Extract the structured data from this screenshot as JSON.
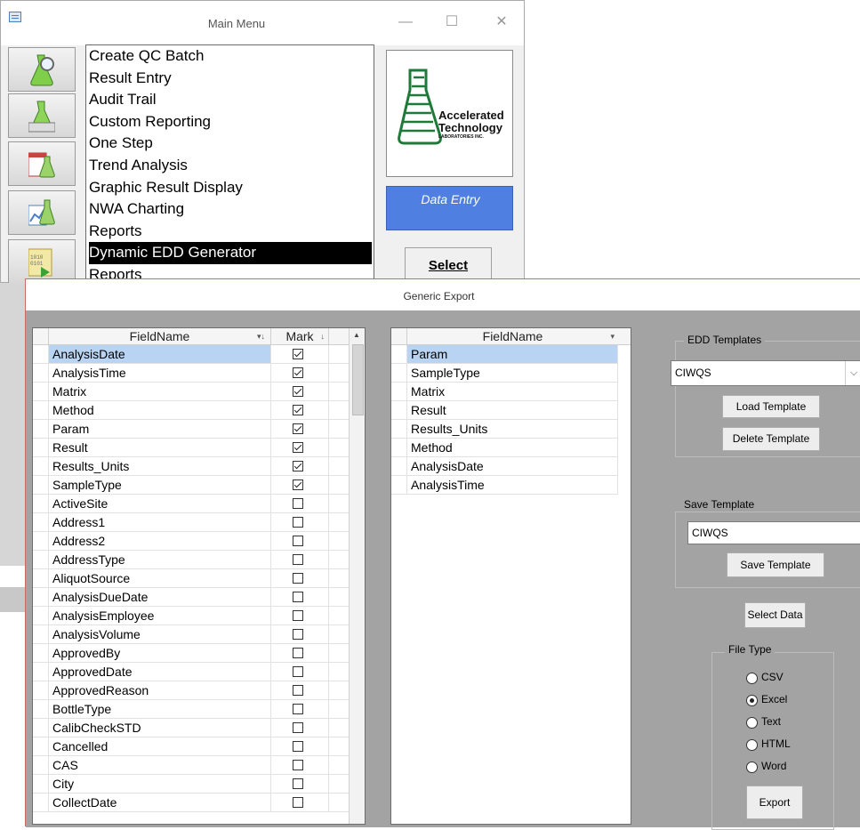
{
  "main_menu": {
    "title": "Main Menu",
    "items": [
      "Create QC Batch",
      "Result Entry",
      "Audit Trail",
      "Custom Reporting",
      "One Step",
      "Trend Analysis",
      "Graphic Result Display",
      "NWA Charting",
      "Reports",
      "Dynamic EDD Generator",
      "Reports"
    ],
    "selected_index": 9,
    "logo": {
      "line1": "Accelerated",
      "line2": "Technology",
      "line3": "LABORATORIES INC."
    },
    "data_entry_label": "Data Entry",
    "select_label": "Select",
    "colors": {
      "data_entry_bg": "#4f7fe0"
    }
  },
  "generic_export": {
    "title": "Generic Export",
    "left_grid": {
      "headers": {
        "field": "FieldName",
        "mark": "Mark"
      },
      "rows": [
        {
          "name": "AnalysisDate",
          "mark": true
        },
        {
          "name": "AnalysisTime",
          "mark": true
        },
        {
          "name": "Matrix",
          "mark": true
        },
        {
          "name": "Method",
          "mark": true
        },
        {
          "name": "Param",
          "mark": true
        },
        {
          "name": "Result",
          "mark": true
        },
        {
          "name": "Results_Units",
          "mark": true
        },
        {
          "name": "SampleType",
          "mark": true
        },
        {
          "name": "ActiveSite",
          "mark": false
        },
        {
          "name": "Address1",
          "mark": false
        },
        {
          "name": "Address2",
          "mark": false
        },
        {
          "name": "AddressType",
          "mark": false
        },
        {
          "name": "AliquotSource",
          "mark": false
        },
        {
          "name": "AnalysisDueDate",
          "mark": false
        },
        {
          "name": "AnalysisEmployee",
          "mark": false
        },
        {
          "name": "AnalysisVolume",
          "mark": false
        },
        {
          "name": "ApprovedBy",
          "mark": false
        },
        {
          "name": "ApprovedDate",
          "mark": false
        },
        {
          "name": "ApprovedReason",
          "mark": false
        },
        {
          "name": "BottleType",
          "mark": false
        },
        {
          "name": "CalibCheckSTD",
          "mark": false
        },
        {
          "name": "Cancelled",
          "mark": false
        },
        {
          "name": "CAS",
          "mark": false
        },
        {
          "name": "City",
          "mark": false
        },
        {
          "name": "CollectDate",
          "mark": false
        }
      ]
    },
    "right_grid": {
      "header": "FieldName",
      "rows": [
        "Param",
        "SampleType",
        "Matrix",
        "Result",
        "Results_Units",
        "Method",
        "AnalysisDate",
        "AnalysisTime"
      ]
    },
    "edd_templates": {
      "label": "EDD Templates",
      "selected": "CIWQS",
      "load_label": "Load Template",
      "delete_label": "Delete Template"
    },
    "save_template": {
      "label": "Save Template",
      "value": "CIWQS",
      "button_label": "Save Template"
    },
    "select_data_label": "Select Data",
    "file_type": {
      "label": "File Type",
      "options": [
        "CSV",
        "Excel",
        "Text",
        "HTML",
        "Word"
      ],
      "selected": "Excel"
    },
    "export_label": "Export"
  }
}
